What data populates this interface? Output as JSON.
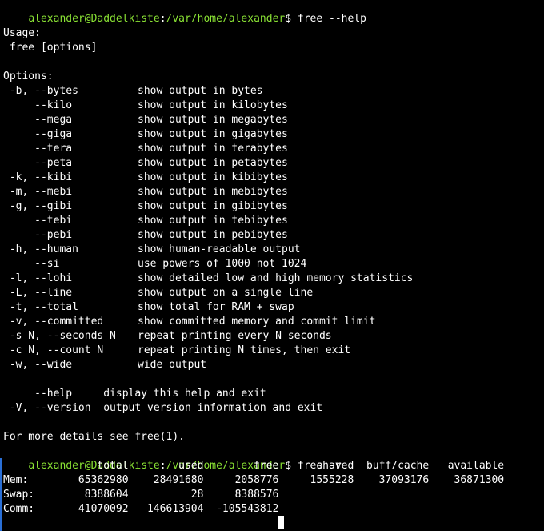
{
  "colors": {
    "background": "#000000",
    "text": "#ffffff",
    "prompt": "#8ae234",
    "cursor": "#ffffff",
    "scroll_marker": "#2a6fd6"
  },
  "prompt": {
    "user_host": "alexander@Daddelkiste",
    "path": "/var/home/alexander",
    "symbol": "$"
  },
  "commands": {
    "first": " free --help",
    "second": " free -v",
    "third": ""
  },
  "help": {
    "usage_header": "Usage:",
    "usage_line": " free [options]",
    "options_header": "Options:",
    "options": [
      {
        "flag": " -b, --bytes",
        "desc": "show output in bytes"
      },
      {
        "flag": "     --kilo",
        "desc": "show output in kilobytes"
      },
      {
        "flag": "     --mega",
        "desc": "show output in megabytes"
      },
      {
        "flag": "     --giga",
        "desc": "show output in gigabytes"
      },
      {
        "flag": "     --tera",
        "desc": "show output in terabytes"
      },
      {
        "flag": "     --peta",
        "desc": "show output in petabytes"
      },
      {
        "flag": " -k, --kibi",
        "desc": "show output in kibibytes"
      },
      {
        "flag": " -m, --mebi",
        "desc": "show output in mebibytes"
      },
      {
        "flag": " -g, --gibi",
        "desc": "show output in gibibytes"
      },
      {
        "flag": "     --tebi",
        "desc": "show output in tebibytes"
      },
      {
        "flag": "     --pebi",
        "desc": "show output in pebibytes"
      },
      {
        "flag": " -h, --human",
        "desc": "show human-readable output"
      },
      {
        "flag": "     --si",
        "desc": "use powers of 1000 not 1024"
      },
      {
        "flag": " -l, --lohi",
        "desc": "show detailed low and high memory statistics"
      },
      {
        "flag": " -L, --line",
        "desc": "show output on a single line"
      },
      {
        "flag": " -t, --total",
        "desc": "show total for RAM + swap"
      },
      {
        "flag": " -v, --committed",
        "desc": "show committed memory and commit limit"
      },
      {
        "flag": " -s N, --seconds N",
        "desc": "repeat printing every N seconds"
      },
      {
        "flag": " -c N, --count N",
        "desc": "repeat printing N times, then exit"
      },
      {
        "flag": " -w, --wide",
        "desc": "wide output"
      }
    ],
    "extra": [
      "     --help     display this help and exit",
      " -V, --version  output version information and exit"
    ],
    "footer": "For more details see free(1)."
  },
  "free_output": {
    "header": "               total        used        free      shared  buff/cache   available",
    "rows": [
      "Mem:        65362980    28491680     2058776     1555228    37093176    36871300",
      "Swap:        8388604          28     8388576",
      "Comm:       41070092   146613904  -105543812"
    ]
  }
}
